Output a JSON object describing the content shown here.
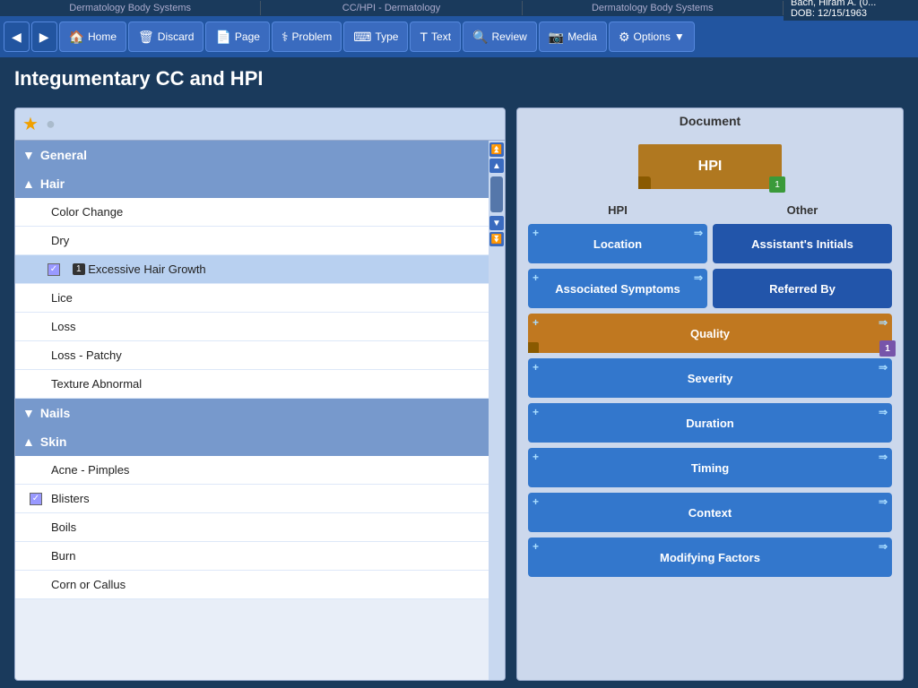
{
  "topbar": {
    "left": "Dermatology Body Systems",
    "center": "CC/HPI - Dermatology",
    "right": "Dermatology Body Systems",
    "patient_name": "Bach, Hiram A. (0...",
    "patient_dob_label": "DOB:",
    "patient_dob": "12/15/1963"
  },
  "navbar": {
    "back_label": "◀",
    "forward_label": "▶",
    "home_label": "Home",
    "discard_label": "Discard",
    "page_label": "Page",
    "problem_label": "Problem",
    "type_label": "Type",
    "text_label": "Text",
    "review_label": "Review",
    "media_label": "Media",
    "options_label": "Options"
  },
  "page_title": "Integumentary CC and HPI",
  "left_panel": {
    "sections": [
      {
        "id": "general",
        "label": "General",
        "collapsed": true,
        "items": []
      },
      {
        "id": "hair",
        "label": "Hair",
        "collapsed": false,
        "items": [
          {
            "id": "color-change",
            "label": "Color Change",
            "selected": false,
            "badge": null,
            "checked": false
          },
          {
            "id": "dry",
            "label": "Dry",
            "selected": false,
            "badge": null,
            "checked": false
          },
          {
            "id": "excessive-hair-growth",
            "label": "Excessive Hair Growth",
            "selected": true,
            "badge": "1",
            "checked": true
          },
          {
            "id": "lice",
            "label": "Lice",
            "selected": false,
            "badge": null,
            "checked": false
          },
          {
            "id": "loss",
            "label": "Loss",
            "selected": false,
            "badge": null,
            "checked": false
          },
          {
            "id": "loss-patchy",
            "label": "Loss - Patchy",
            "selected": false,
            "badge": null,
            "checked": false
          },
          {
            "id": "texture-abnormal",
            "label": "Texture Abnormal",
            "selected": false,
            "badge": null,
            "checked": false
          }
        ]
      },
      {
        "id": "nails",
        "label": "Nails",
        "collapsed": true,
        "items": []
      },
      {
        "id": "skin",
        "label": "Skin",
        "collapsed": false,
        "items": [
          {
            "id": "acne-pimples",
            "label": "Acne - Pimples",
            "selected": false,
            "badge": null,
            "checked": false
          },
          {
            "id": "blisters",
            "label": "Blisters",
            "selected": false,
            "badge": null,
            "checked": true
          },
          {
            "id": "boils",
            "label": "Boils",
            "selected": false,
            "badge": null,
            "checked": false
          },
          {
            "id": "burn",
            "label": "Burn",
            "selected": false,
            "badge": null,
            "checked": false
          },
          {
            "id": "corn-callus",
            "label": "Corn or Callus",
            "selected": false,
            "badge": null,
            "checked": false
          }
        ]
      }
    ]
  },
  "right_panel": {
    "title": "Document",
    "doc_thumb_label": "HPI",
    "doc_thumb_badge": "1",
    "hpi_label": "HPI",
    "other_label": "Other",
    "hpi_buttons": [
      {
        "id": "location",
        "label": "Location",
        "has_plus": true,
        "has_arrow": true,
        "orange": false,
        "badge": null
      },
      {
        "id": "associated-symptoms",
        "label": "Associated Symptoms",
        "has_plus": true,
        "has_arrow": true,
        "orange": false,
        "badge": null
      },
      {
        "id": "quality",
        "label": "Quality",
        "has_plus": true,
        "has_arrow": true,
        "orange": true,
        "badge": "1"
      },
      {
        "id": "severity",
        "label": "Severity",
        "has_plus": true,
        "has_arrow": true,
        "orange": false,
        "badge": null
      },
      {
        "id": "duration",
        "label": "Duration",
        "has_plus": true,
        "has_arrow": true,
        "orange": false,
        "badge": null
      },
      {
        "id": "timing",
        "label": "Timing",
        "has_plus": true,
        "has_arrow": true,
        "orange": false,
        "badge": null
      },
      {
        "id": "context",
        "label": "Context",
        "has_plus": true,
        "has_arrow": true,
        "orange": false,
        "badge": null
      },
      {
        "id": "modifying-factors",
        "label": "Modifying Factors",
        "has_plus": true,
        "has_arrow": true,
        "orange": false,
        "badge": null
      }
    ],
    "other_buttons": [
      {
        "id": "assistants-initials",
        "label": "Assistant's Initials"
      },
      {
        "id": "referred-by",
        "label": "Referred By"
      }
    ]
  }
}
